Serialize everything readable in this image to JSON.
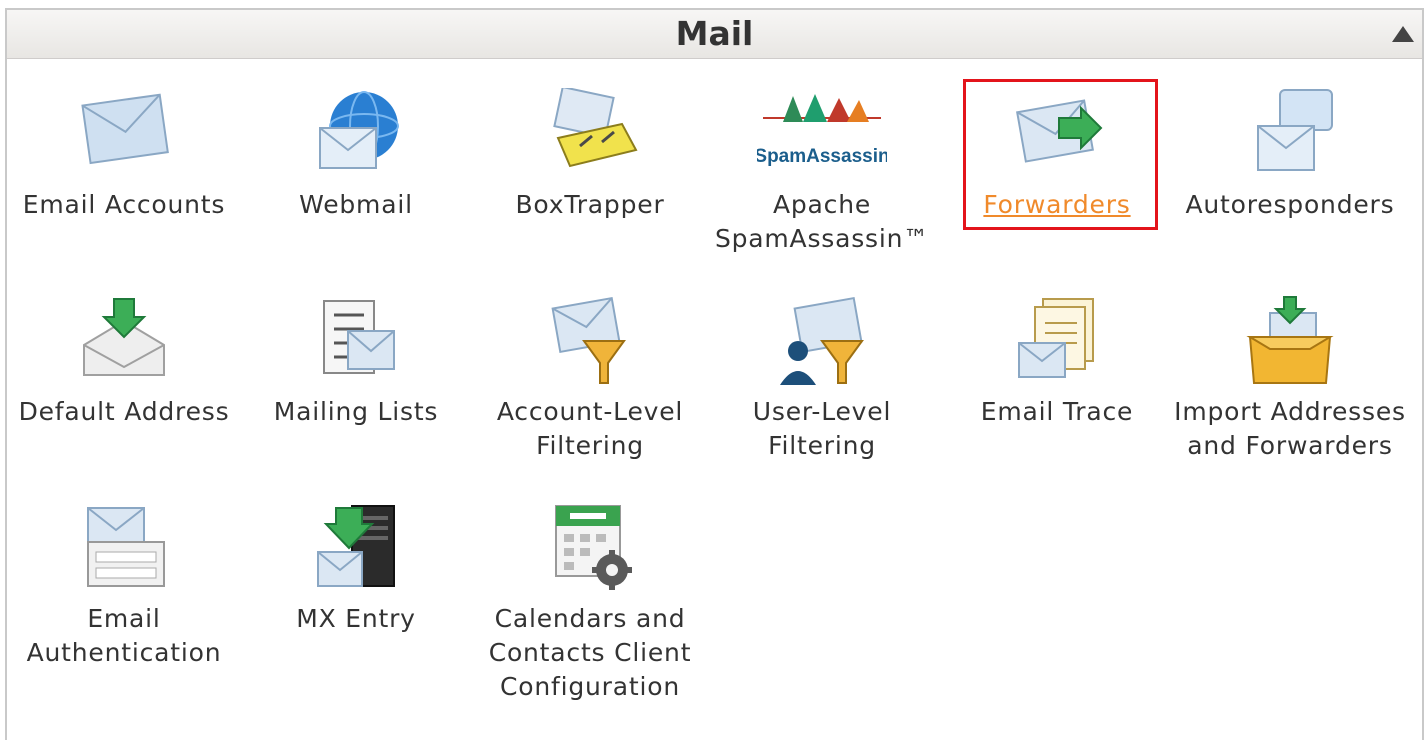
{
  "panel": {
    "title": "Mail",
    "collapse_icon": "triangle-up-icon"
  },
  "items": [
    {
      "label": "Email Accounts",
      "icon": "envelope-icon"
    },
    {
      "label": "Webmail",
      "icon": "globe-envelope-icon"
    },
    {
      "label": "BoxTrapper",
      "icon": "trap-envelope-icon"
    },
    {
      "label": "Apache SpamAssassin™",
      "icon": "spamassassin-icon",
      "icon_text": "SpamAssassin"
    },
    {
      "label": "Forwarders",
      "icon": "forward-envelope-icon",
      "active": true
    },
    {
      "label": "Autoresponders",
      "icon": "speech-envelope-icon"
    },
    {
      "label": "Default Address",
      "icon": "download-envelope-icon"
    },
    {
      "label": "Mailing Lists",
      "icon": "list-envelope-icon"
    },
    {
      "label": "Account-Level Filtering",
      "icon": "funnel-envelope-icon"
    },
    {
      "label": "User-Level Filtering",
      "icon": "user-funnel-envelope-icon"
    },
    {
      "label": "Email Trace",
      "icon": "documents-envelope-icon"
    },
    {
      "label": "Import Addresses and Forwarders",
      "icon": "import-box-icon"
    },
    {
      "label": "Email Authentication",
      "icon": "auth-envelope-icon"
    },
    {
      "label": "MX Entry",
      "icon": "server-arrow-icon"
    },
    {
      "label": "Calendars and Contacts Client Configuration",
      "icon": "calendar-gear-icon"
    }
  ],
  "colors": {
    "highlight": "#e3141b",
    "active_link": "#f08a2b",
    "text": "#333333"
  }
}
